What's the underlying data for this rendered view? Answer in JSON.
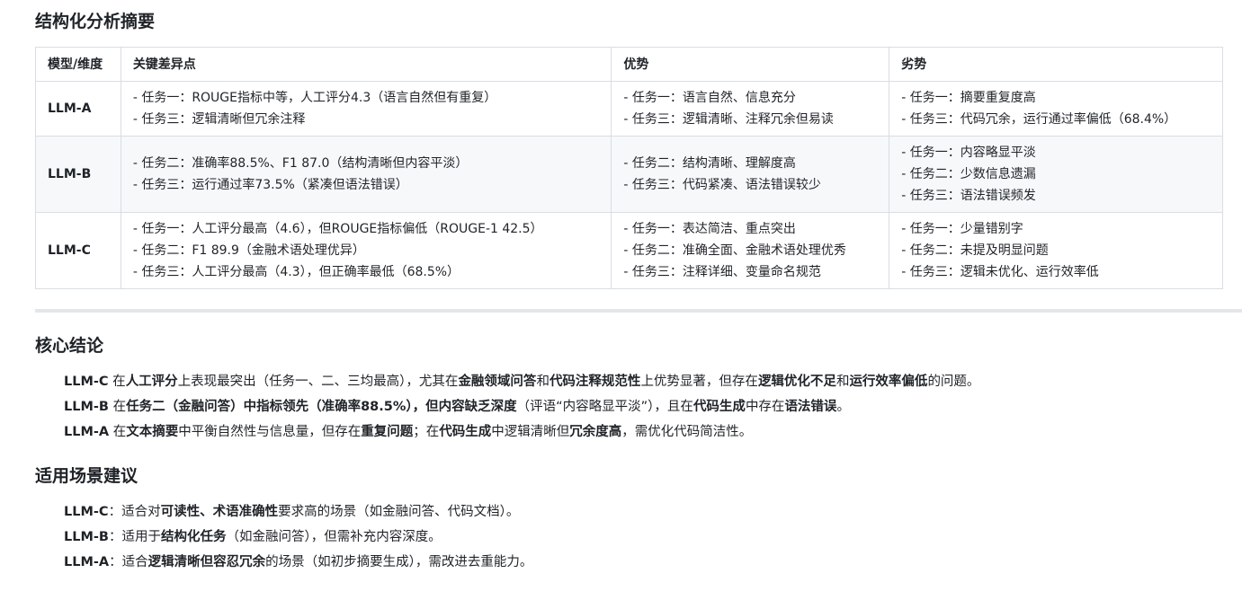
{
  "summary": {
    "title": "结构化分析摘要",
    "headers": [
      "模型/维度",
      "关键差异点",
      "优势",
      "劣势"
    ],
    "rows": [
      {
        "model": "LLM-A",
        "diff": [
          "- 任务一：ROUGE指标中等，人工评分4.3（语言自然但有重复）",
          "- 任务三：逻辑清晰但冗余注释"
        ],
        "pros": [
          "- 任务一：语言自然、信息充分",
          "- 任务三：逻辑清晰、注释冗余但易读"
        ],
        "cons": [
          "- 任务一：摘要重复度高",
          "- 任务三：代码冗余，运行通过率偏低（68.4%）"
        ]
      },
      {
        "model": "LLM-B",
        "diff": [
          "- 任务二：准确率88.5%、F1 87.0（结构清晰但内容平淡）",
          "- 任务三：运行通过率73.5%（紧凑但语法错误）"
        ],
        "pros": [
          "- 任务二：结构清晰、理解度高",
          "- 任务三：代码紧凑、语法错误较少"
        ],
        "cons": [
          "- 任务一：内容略显平淡",
          "- 任务二：少数信息遗漏",
          "- 任务三：语法错误频发"
        ]
      },
      {
        "model": "LLM-C",
        "diff": [
          "- 任务一：人工评分最高（4.6），但ROUGE指标偏低（ROUGE-1 42.5）",
          "- 任务二：F1 89.9（金融术语处理优异）",
          "- 任务三：人工评分最高（4.3），但正确率最低（68.5%）"
        ],
        "pros": [
          "- 任务一：表达简洁、重点突出",
          "- 任务二：准确全面、金融术语处理优秀",
          "- 任务三：注释详细、变量命名规范"
        ],
        "cons": [
          "- 任务一：少量错别字",
          "- 任务二：未提及明显问题",
          "- 任务三：逻辑未优化、运行效率低"
        ]
      }
    ]
  },
  "conclusion": {
    "title": "核心结论",
    "items": [
      [
        {
          "t": "LLM-C",
          "b": true
        },
        {
          "t": " 在"
        },
        {
          "t": "人工评分",
          "b": true
        },
        {
          "t": "上表现最突出（任务一、二、三均最高），尤其在"
        },
        {
          "t": "金融领域问答",
          "b": true
        },
        {
          "t": "和"
        },
        {
          "t": "代码注释规范性",
          "b": true
        },
        {
          "t": "上优势显著，但存在"
        },
        {
          "t": "逻辑优化不足",
          "b": true
        },
        {
          "t": "和"
        },
        {
          "t": "运行效率偏低",
          "b": true
        },
        {
          "t": "的问题。"
        }
      ],
      [
        {
          "t": "LLM-B",
          "b": true
        },
        {
          "t": " 在"
        },
        {
          "t": "任务二（金融问答）中指标领先（准确率88.5%），但内容缺乏深度",
          "b": true
        },
        {
          "t": "（评语“内容略显平淡”），且在"
        },
        {
          "t": "代码生成",
          "b": true
        },
        {
          "t": "中存在"
        },
        {
          "t": "语法错误",
          "b": true
        },
        {
          "t": "。"
        }
      ],
      [
        {
          "t": "LLM-A",
          "b": true
        },
        {
          "t": " 在"
        },
        {
          "t": "文本摘要",
          "b": true
        },
        {
          "t": "中平衡自然性与信息量，但存在"
        },
        {
          "t": "重复问题",
          "b": true
        },
        {
          "t": "；在"
        },
        {
          "t": "代码生成",
          "b": true
        },
        {
          "t": "中逻辑清晰但"
        },
        {
          "t": "冗余度高",
          "b": true
        },
        {
          "t": "，需优化代码简洁性。"
        }
      ]
    ]
  },
  "scenario": {
    "title": "适用场景建议",
    "items": [
      [
        {
          "t": "LLM-C",
          "b": true
        },
        {
          "t": "：适合对"
        },
        {
          "t": "可读性、术语准确性",
          "b": true
        },
        {
          "t": "要求高的场景（如金融问答、代码文档）。"
        }
      ],
      [
        {
          "t": "LLM-B",
          "b": true
        },
        {
          "t": "：适用于"
        },
        {
          "t": "结构化任务",
          "b": true
        },
        {
          "t": "（如金融问答），但需补充内容深度。"
        }
      ],
      [
        {
          "t": "LLM-A",
          "b": true
        },
        {
          "t": "：适合"
        },
        {
          "t": "逻辑清晰但容忍冗余",
          "b": true
        },
        {
          "t": "的场景（如初步摘要生成），需改进去重能力。"
        }
      ]
    ]
  }
}
